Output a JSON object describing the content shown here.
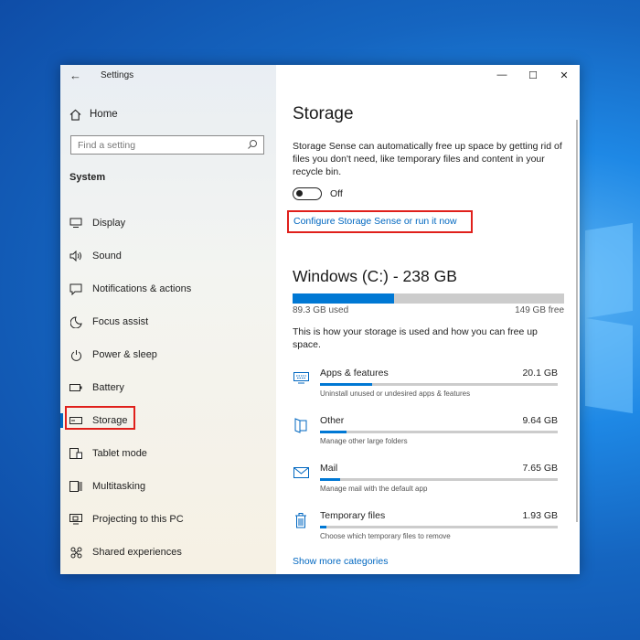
{
  "window": {
    "title": "Settings",
    "controls": {
      "minimize": "—",
      "maximize": "☐",
      "close": "✕"
    }
  },
  "sidebar": {
    "home_label": "Home",
    "search_placeholder": "Find a setting",
    "section_title": "System",
    "items": [
      {
        "label": "Display",
        "icon": "display-icon"
      },
      {
        "label": "Sound",
        "icon": "sound-icon"
      },
      {
        "label": "Notifications & actions",
        "icon": "notifications-icon"
      },
      {
        "label": "Focus assist",
        "icon": "moon-icon"
      },
      {
        "label": "Power & sleep",
        "icon": "power-icon"
      },
      {
        "label": "Battery",
        "icon": "battery-icon"
      },
      {
        "label": "Storage",
        "icon": "storage-icon",
        "selected": true
      },
      {
        "label": "Tablet mode",
        "icon": "tablet-icon"
      },
      {
        "label": "Multitasking",
        "icon": "multitasking-icon"
      },
      {
        "label": "Projecting to this PC",
        "icon": "projecting-icon"
      },
      {
        "label": "Shared experiences",
        "icon": "shared-icon"
      }
    ]
  },
  "main": {
    "title": "Storage",
    "storage_sense": {
      "description": "Storage Sense can automatically free up space by getting rid of files you don't need, like temporary files and content in your recycle bin.",
      "toggle_label": "Off",
      "toggle_on": false,
      "configure_link": "Configure Storage Sense or run it now"
    },
    "drive": {
      "title": "Windows (C:) - 238 GB",
      "used": "89.3 GB used",
      "free": "149 GB free",
      "used_fraction": 0.375
    },
    "info": "This is how your storage is used and how you can free up space.",
    "categories": [
      {
        "name": "Apps & features",
        "size": "20.1 GB",
        "sub": "Uninstall unused or undesired apps & features",
        "fraction": 0.22,
        "icon": "apps-icon"
      },
      {
        "name": "Other",
        "size": "9.64 GB",
        "sub": "Manage other large folders",
        "fraction": 0.11,
        "icon": "other-icon"
      },
      {
        "name": "Mail",
        "size": "7.65 GB",
        "sub": "Manage mail with the default app",
        "fraction": 0.085,
        "icon": "mail-icon"
      },
      {
        "name": "Temporary files",
        "size": "1.93 GB",
        "sub": "Choose which temporary files to remove",
        "fraction": 0.025,
        "icon": "trash-icon"
      }
    ],
    "more_link": "Show more categories"
  },
  "colors": {
    "accent": "#0078d4",
    "link": "#0067c0",
    "highlight": "#e0201b"
  }
}
